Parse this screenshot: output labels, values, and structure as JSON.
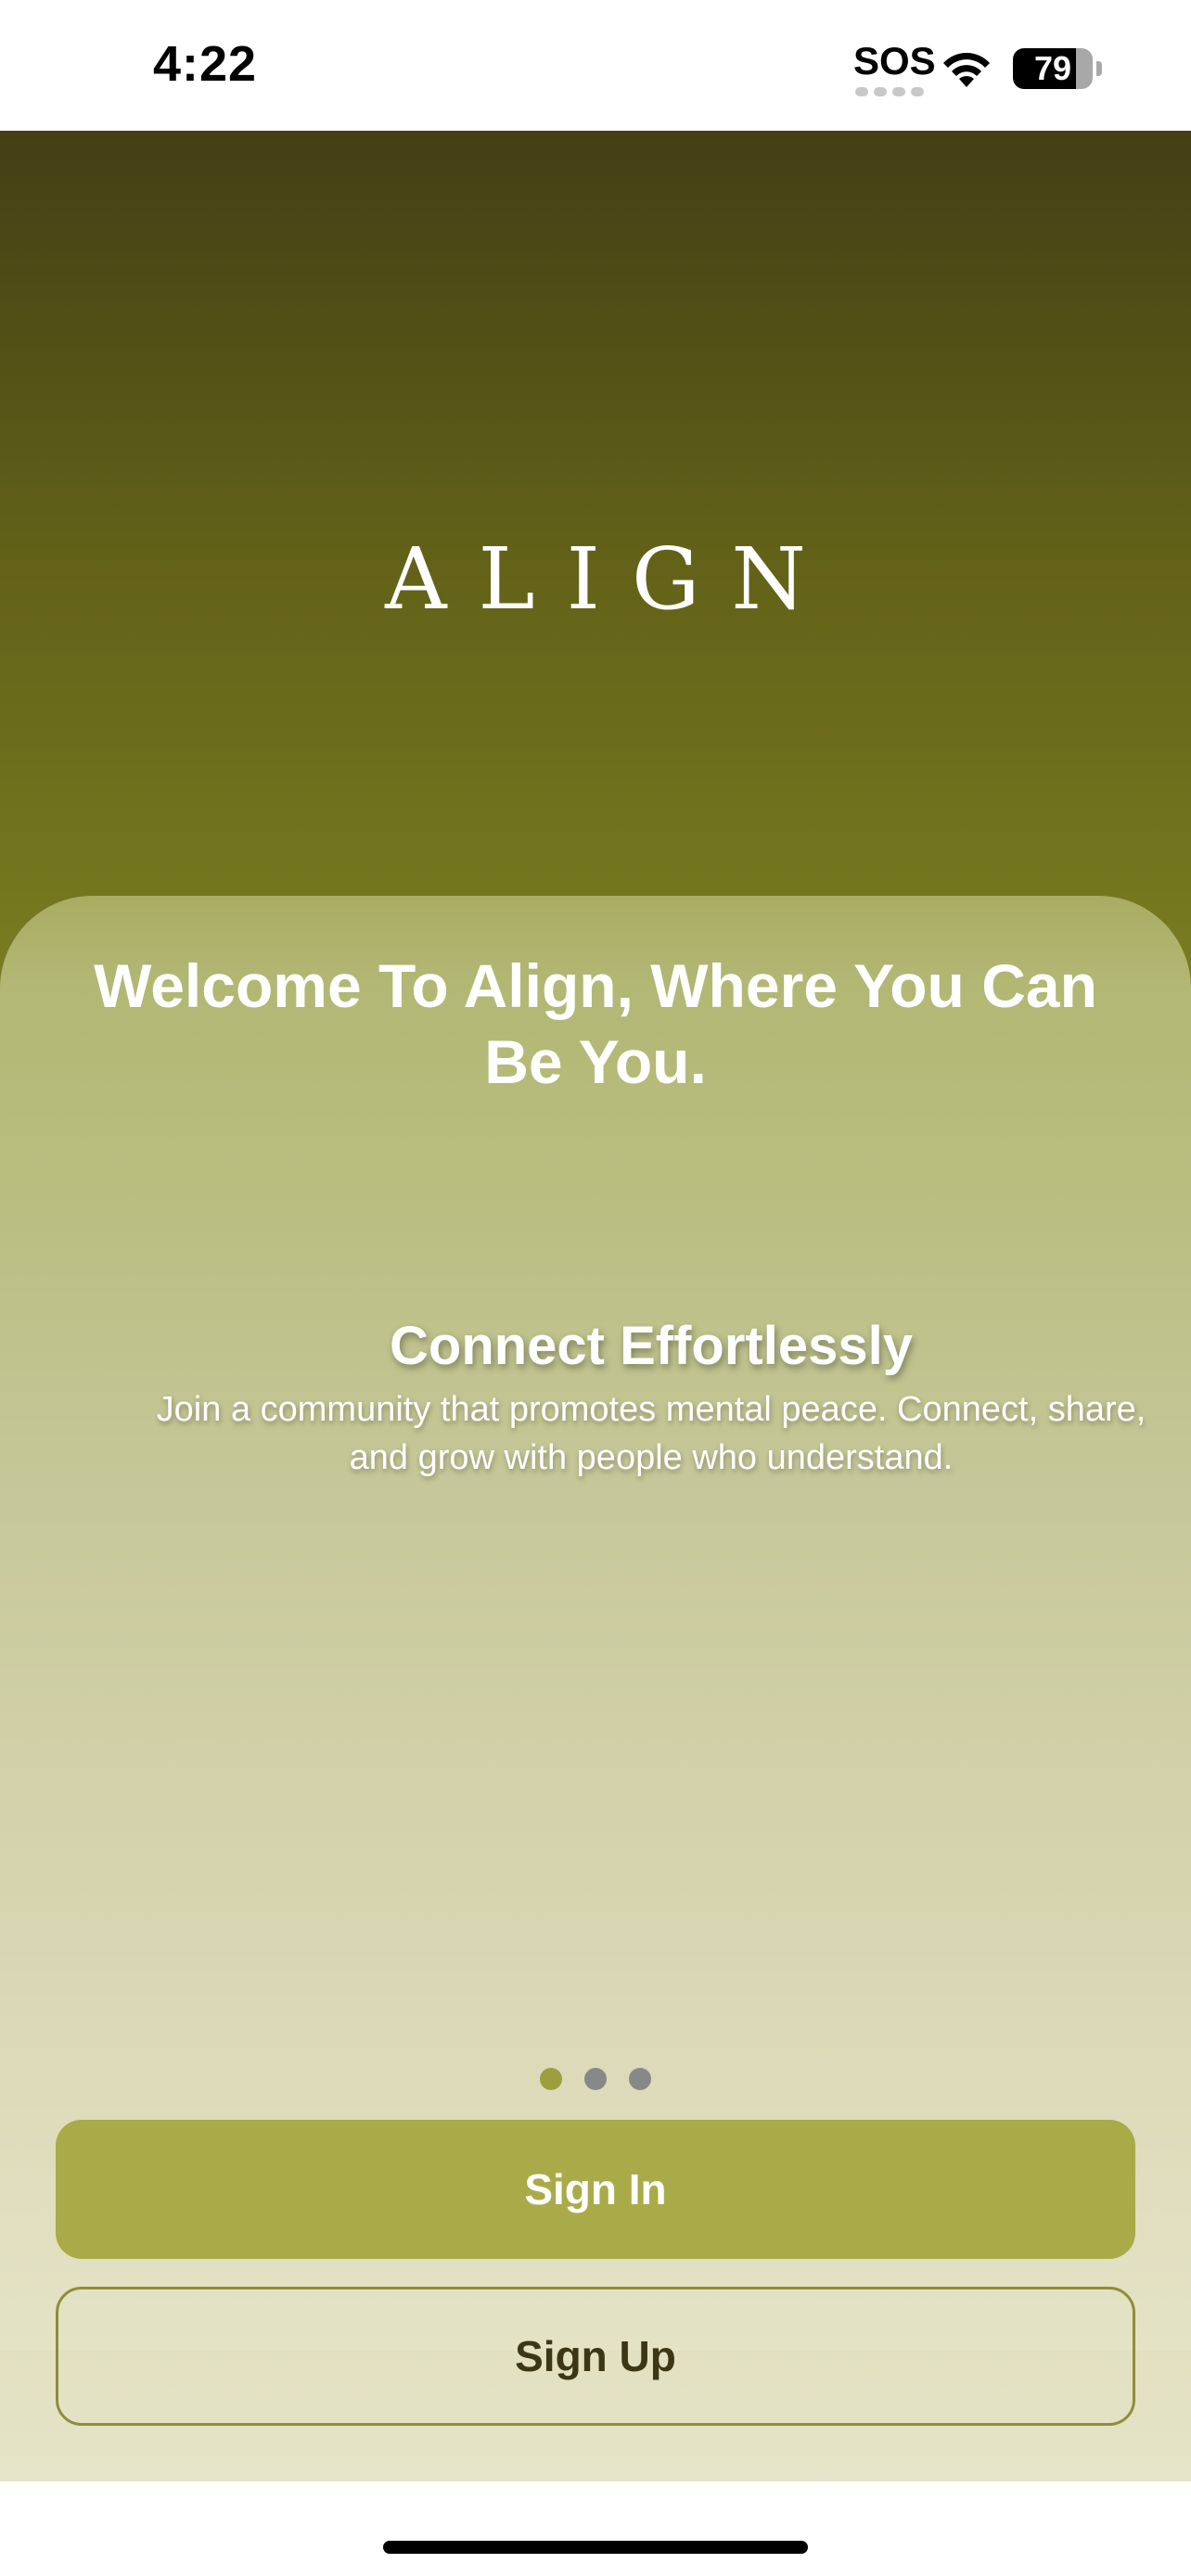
{
  "status_bar": {
    "time": "4:22",
    "carrier_status": "SOS",
    "battery_level": "79",
    "wifi_icon": "wifi-icon"
  },
  "hero": {
    "logo_text": "ALIGN"
  },
  "panel": {
    "welcome_title": "Welcome To Align, Where You Can Be You.",
    "feature_title": "Connect Effortlessly",
    "feature_description": "Join a community that promotes mental peace. Connect, share, and grow with people who understand."
  },
  "pager": {
    "total_pages": 3,
    "active_index": 0
  },
  "actions": {
    "sign_in_label": "Sign In",
    "sign_up_label": "Sign Up"
  },
  "colors": {
    "accent": "#a8ab48",
    "dark_olive": "#443f15",
    "signup_border": "#8e8e3a",
    "dot_inactive": "#888888"
  }
}
